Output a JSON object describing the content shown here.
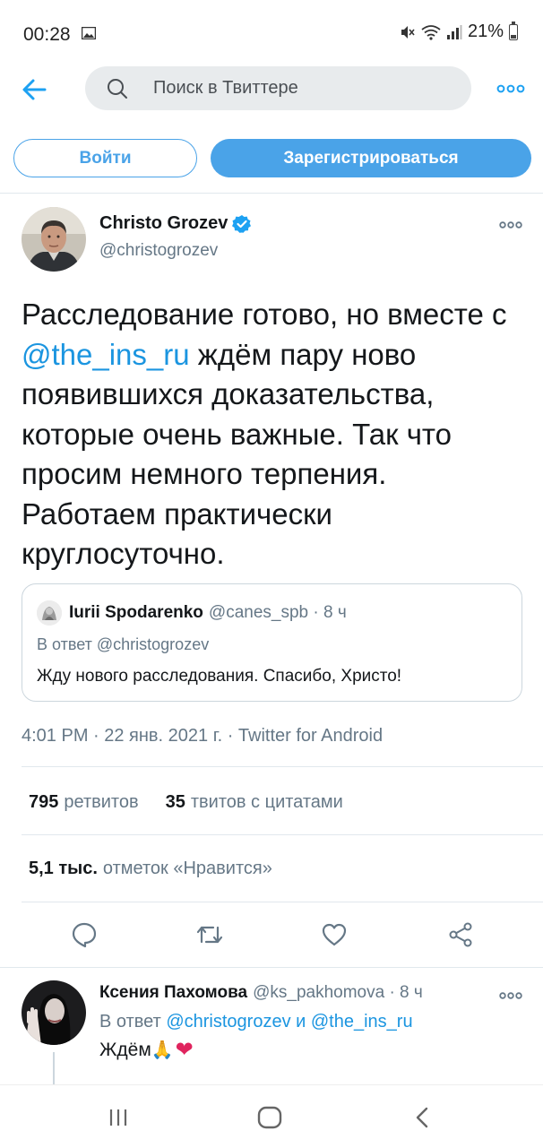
{
  "status_bar": {
    "time": "00:28",
    "battery": "21%"
  },
  "header": {
    "search_placeholder": "Поиск в Твиттере"
  },
  "auth": {
    "login_label": "Войти",
    "signup_label": "Зарегистрироваться"
  },
  "tweet": {
    "author_name": "Christo Grozev",
    "author_handle": "@christogrozev",
    "text_part1": "Расследование готово, но вместе с ",
    "mention": "@the_ins_ru",
    "text_part2": " ждём пару ново появившихся доказательства, которые очень важные. Так что просим немного терпения. Работаем практически круглосуточно.",
    "timestamp": "4:01 PM · 22 янв. 2021 г. · Twitter for Android",
    "retweets_count": "795",
    "retweets_label": "ретвитов",
    "quotes_count": "35",
    "quotes_label": "твитов с цитатами",
    "likes_count": "5,1 тыс.",
    "likes_label": "отметок «Нравится»"
  },
  "quoted": {
    "name": "Iurii Spodarenko",
    "handle": "@canes_spb · 8 ч",
    "reply_to": "В ответ @christogrozev",
    "text": "Жду нового расследования. Спасибо, Христо!"
  },
  "reply": {
    "name": "Ксения Пахомова",
    "handle": "@ks_pakhomova · 8 ч",
    "reply_prefix": "В ответ ",
    "reply_mention1": "@christogrozev",
    "reply_and": " и ",
    "reply_mention2": "@the_ins_ru",
    "text": "Ждём",
    "emoji_1": "🙏",
    "emoji_2": "❤"
  },
  "colors": {
    "accent": "#4aa3e8",
    "link": "#1b95e0",
    "muted": "#657786"
  }
}
